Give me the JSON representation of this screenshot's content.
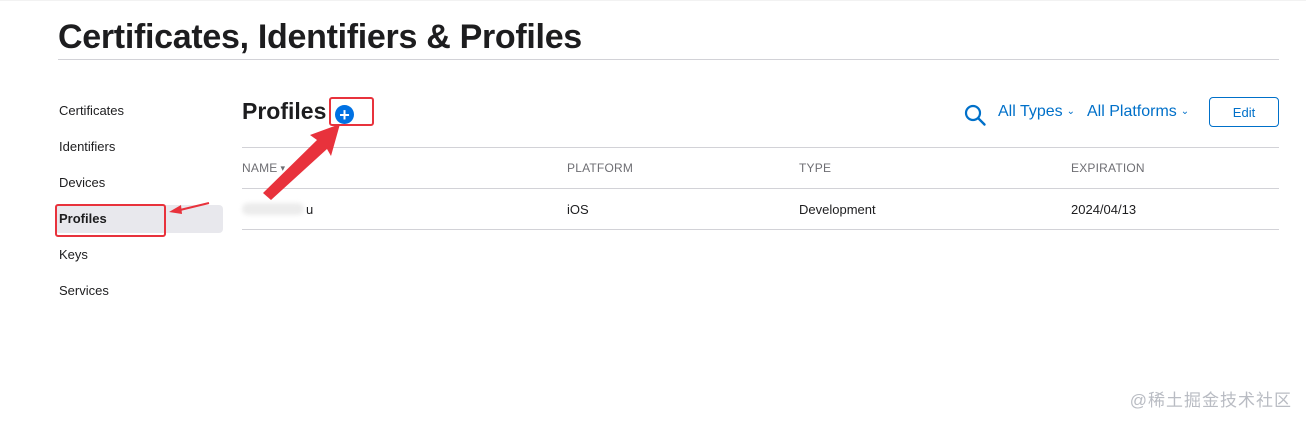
{
  "header": {
    "title": "Certificates, Identifiers & Profiles"
  },
  "sidebar": {
    "items": [
      {
        "label": "Certificates",
        "active": false
      },
      {
        "label": "Identifiers",
        "active": false
      },
      {
        "label": "Devices",
        "active": false
      },
      {
        "label": "Profiles",
        "active": true
      },
      {
        "label": "Keys",
        "active": false
      },
      {
        "label": "Services",
        "active": false
      }
    ]
  },
  "main": {
    "section_title": "Profiles",
    "add_label": "+",
    "filters": {
      "types": "All Types",
      "platforms": "All Platforms"
    },
    "edit_label": "Edit",
    "table": {
      "columns": [
        "NAME",
        "PLATFORM",
        "TYPE",
        "EXPIRATION"
      ],
      "rows": [
        {
          "name_visible": "u",
          "platform": "iOS",
          "type": "Development",
          "expiration": "2024/04/13"
        }
      ]
    }
  },
  "icons": {
    "search": "search-icon",
    "add": "plus-circle-icon",
    "caret": "chevron-down-icon",
    "sort": "sort-arrow-icon"
  },
  "colors": {
    "accent": "#0071e3",
    "link": "#0070c9",
    "annotation": "#e8323c",
    "active_sidebar_bg": "#e8e8ed"
  },
  "watermark": "@稀土掘金技术社区"
}
